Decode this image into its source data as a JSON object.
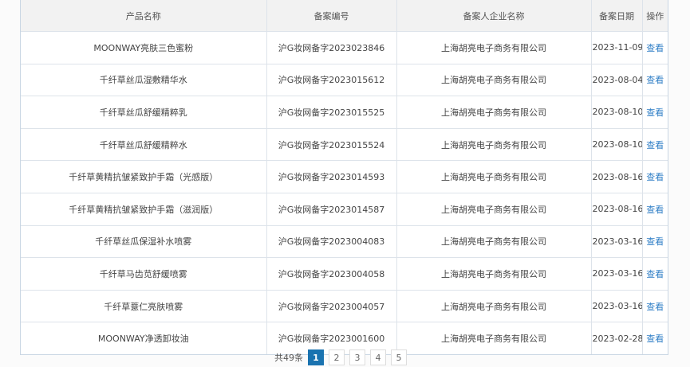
{
  "table": {
    "headers": [
      "产品名称",
      "备案编号",
      "备案人企业名称",
      "备案日期",
      "操作"
    ],
    "rows": [
      {
        "name": "MOONWAY亮肤三色蜜粉",
        "code": "沪G妆网备字2023023846",
        "company": "上海胡亮电子商务有限公司",
        "date": "2023-11-09",
        "action": "查看"
      },
      {
        "name": "千纤草丝瓜湿敷精华水",
        "code": "沪G妆网备字2023015612",
        "company": "上海胡亮电子商务有限公司",
        "date": "2023-08-04",
        "action": "查看"
      },
      {
        "name": "千纤草丝瓜舒缓精粹乳",
        "code": "沪G妆网备字2023015525",
        "company": "上海胡亮电子商务有限公司",
        "date": "2023-08-10",
        "action": "查看"
      },
      {
        "name": "千纤草丝瓜舒缓精粹水",
        "code": "沪G妆网备字2023015524",
        "company": "上海胡亮电子商务有限公司",
        "date": "2023-08-10",
        "action": "查看"
      },
      {
        "name": "千纤草黄精抗皱紧致护手霜（光感版）",
        "code": "沪G妆网备字2023014593",
        "company": "上海胡亮电子商务有限公司",
        "date": "2023-08-16",
        "action": "查看"
      },
      {
        "name": "千纤草黄精抗皱紧致护手霜（滋润版）",
        "code": "沪G妆网备字2023014587",
        "company": "上海胡亮电子商务有限公司",
        "date": "2023-08-16",
        "action": "查看"
      },
      {
        "name": "千纤草丝瓜保湿补水喷雾",
        "code": "沪G妆网备字2023004083",
        "company": "上海胡亮电子商务有限公司",
        "date": "2023-03-16",
        "action": "查看"
      },
      {
        "name": "千纤草马齿苋舒缓喷雾",
        "code": "沪G妆网备字2023004058",
        "company": "上海胡亮电子商务有限公司",
        "date": "2023-03-16",
        "action": "查看"
      },
      {
        "name": "千纤草薏仁亮肤喷雾",
        "code": "沪G妆网备字2023004057",
        "company": "上海胡亮电子商务有限公司",
        "date": "2023-03-16",
        "action": "查看"
      },
      {
        "name": "MOONWAY净透卸妆油",
        "code": "沪G妆网备字2023001600",
        "company": "上海胡亮电子商务有限公司",
        "date": "2023-02-28",
        "action": "查看"
      }
    ]
  },
  "pagination": {
    "total": "共49条",
    "pages": [
      "1",
      "2",
      "3",
      "4",
      "5"
    ],
    "current": "1"
  }
}
